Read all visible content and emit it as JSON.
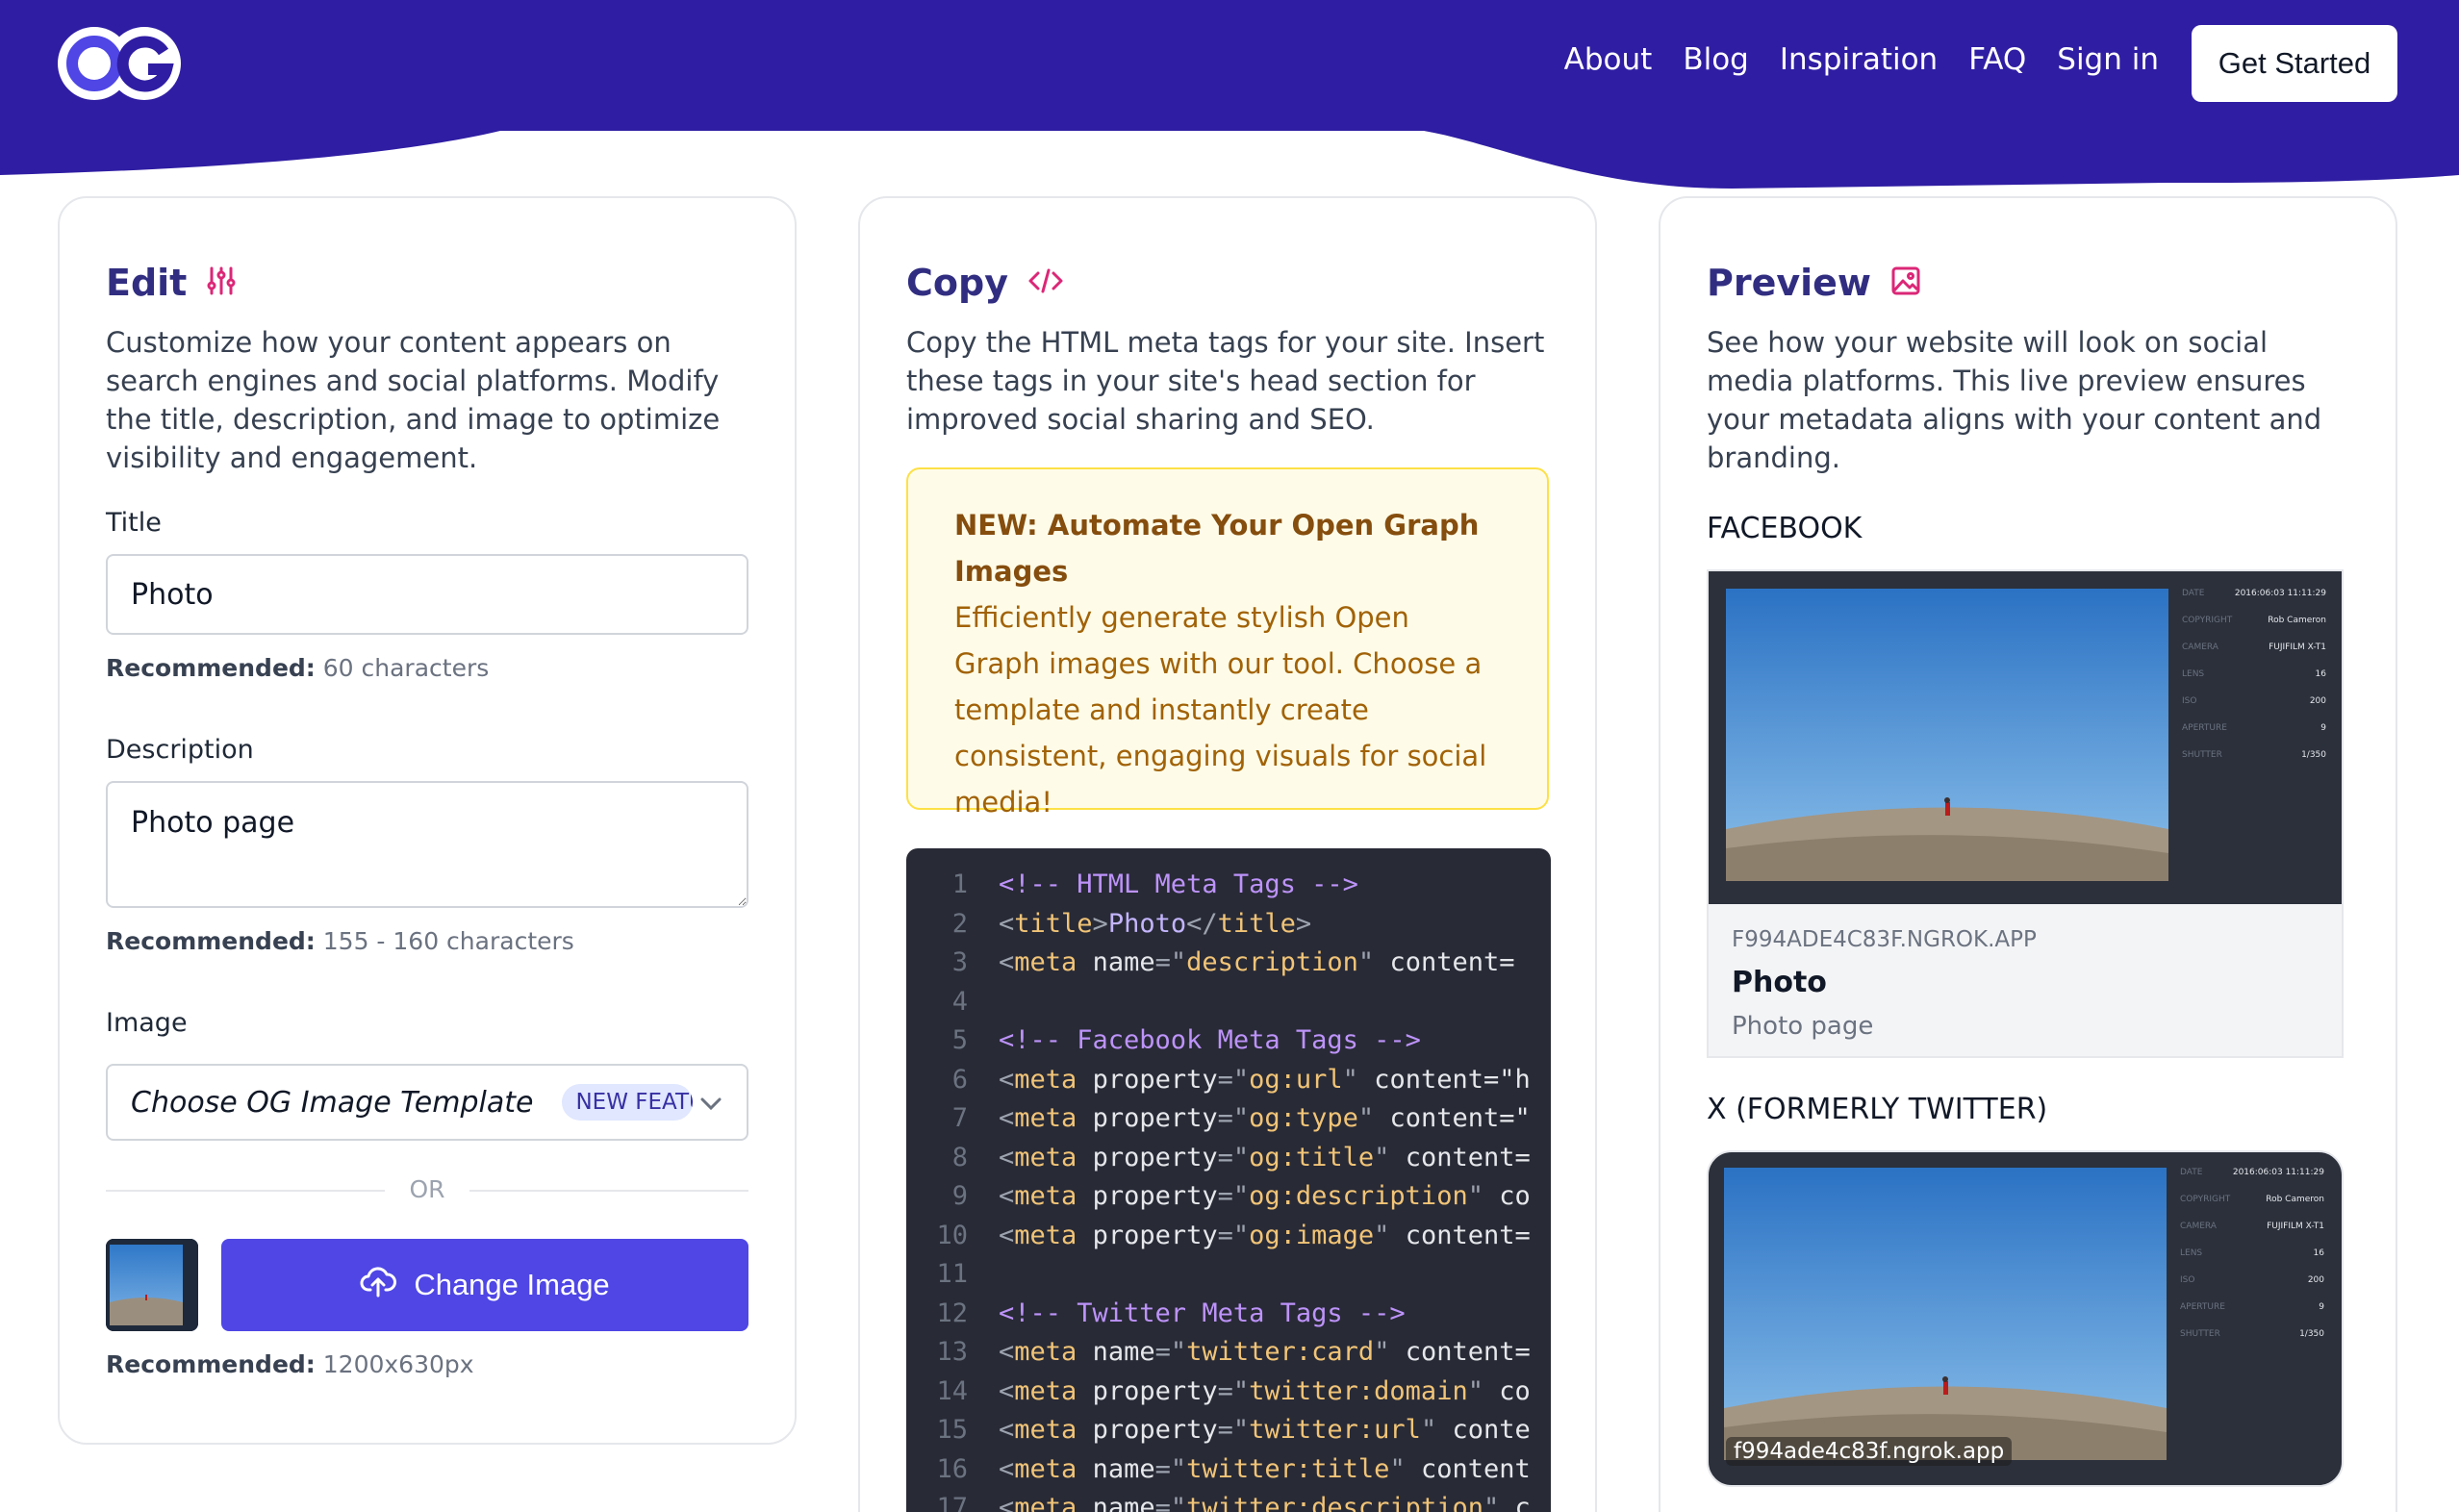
{
  "header": {
    "logo_text": "OG",
    "nav": [
      "About",
      "Blog",
      "Inspiration",
      "FAQ",
      "Sign in"
    ],
    "cta": "Get Started",
    "colors": {
      "brand": "#2f1da3",
      "accent": "#4f46e5"
    }
  },
  "edit": {
    "title": "Edit",
    "icon": "sliders-icon",
    "description": "Customize how your content appears on search engines and social platforms. Modify the title, description, and image to optimize visibility and engagement.",
    "title_label": "Title",
    "title_value": "Photo",
    "title_hint_label": "Recommended:",
    "title_hint_value": "60 characters",
    "desc_label": "Description",
    "desc_value": "Photo page",
    "desc_hint_label": "Recommended:",
    "desc_hint_value": "155 - 160 characters",
    "image_label": "Image",
    "template_select": "Choose OG Image Template",
    "template_badge": "NEW FEATURE",
    "or_text": "OR",
    "change_image": "Change Image",
    "image_hint_label": "Recommended:",
    "image_hint_value": "1200x630px"
  },
  "copy": {
    "title": "Copy",
    "icon": "code-icon",
    "description": "Copy the HTML meta tags for your site. Insert these tags in your site's head section for improved social sharing and SEO.",
    "notice_title": "NEW: Automate Your Open Graph Images",
    "notice_body": "Efficiently generate stylish Open Graph images with our tool. Choose a template and instantly create consistent, engaging visuals for social media!",
    "code_lines": [
      {
        "n": "1",
        "kind": "comment",
        "text": "<!-- HTML Meta Tags -->"
      },
      {
        "n": "2",
        "kind": "title",
        "tag": "title",
        "inner": "Photo"
      },
      {
        "n": "3",
        "kind": "meta",
        "attr": "name",
        "val": "description",
        "rest": " content="
      },
      {
        "n": "4",
        "kind": "blank"
      },
      {
        "n": "5",
        "kind": "comment",
        "text": "<!-- Facebook Meta Tags -->"
      },
      {
        "n": "6",
        "kind": "meta",
        "attr": "property",
        "val": "og:url",
        "rest": " content=\"h"
      },
      {
        "n": "7",
        "kind": "meta",
        "attr": "property",
        "val": "og:type",
        "rest": " content=\""
      },
      {
        "n": "8",
        "kind": "meta",
        "attr": "property",
        "val": "og:title",
        "rest": " content="
      },
      {
        "n": "9",
        "kind": "meta",
        "attr": "property",
        "val": "og:description",
        "rest": " co"
      },
      {
        "n": "10",
        "kind": "meta",
        "attr": "property",
        "val": "og:image",
        "rest": " content="
      },
      {
        "n": "11",
        "kind": "blank"
      },
      {
        "n": "12",
        "kind": "comment",
        "text": "<!-- Twitter Meta Tags -->"
      },
      {
        "n": "13",
        "kind": "meta",
        "attr": "name",
        "val": "twitter:card",
        "rest": " content="
      },
      {
        "n": "14",
        "kind": "meta",
        "attr": "property",
        "val": "twitter:domain",
        "rest": " co"
      },
      {
        "n": "15",
        "kind": "meta",
        "attr": "property",
        "val": "twitter:url",
        "rest": " conte"
      },
      {
        "n": "16",
        "kind": "meta",
        "attr": "name",
        "val": "twitter:title",
        "rest": " content"
      },
      {
        "n": "17",
        "kind": "meta",
        "attr": "name",
        "val": "twitter:description",
        "rest": " c"
      }
    ]
  },
  "preview": {
    "title": "Preview",
    "icon": "image-icon",
    "description": "See how your website will look on social media platforms. This live preview ensures your metadata aligns with your content and branding.",
    "facebook_label": "FACEBOOK",
    "fb_domain": "F994ADE4C83F.NGROK.APP",
    "fb_title": "Photo",
    "fb_desc": "Photo page",
    "x_label": "X (FORMERLY TWITTER)",
    "x_domain": "f994ade4c83f.ngrok.app",
    "photo_meta": [
      {
        "k": "DATE",
        "v": "2016:06:03 11:11:29"
      },
      {
        "k": "COPYRIGHT",
        "v": "Rob Cameron"
      },
      {
        "k": "CAMERA",
        "v": "FUJIFILM X-T1"
      },
      {
        "k": "LENS",
        "v": "16"
      },
      {
        "k": "ISO",
        "v": "200"
      },
      {
        "k": "APERTURE",
        "v": "9"
      },
      {
        "k": "SHUTTER",
        "v": "1/350"
      }
    ]
  }
}
